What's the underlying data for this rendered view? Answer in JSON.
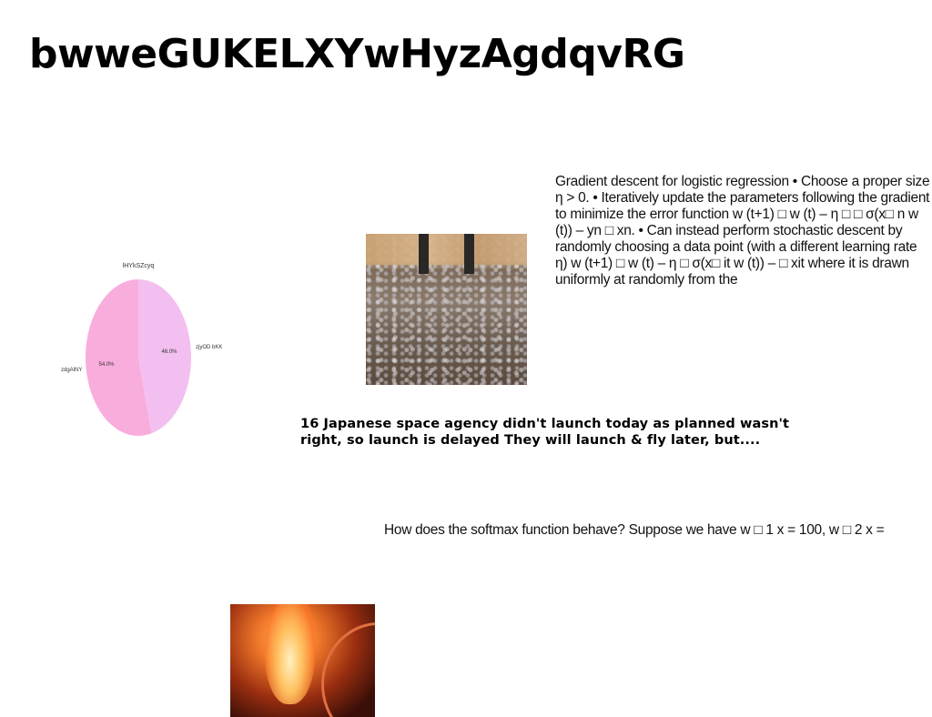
{
  "page": {
    "title": "bwweGUKELXYwHyzAgdqvRG"
  },
  "text_blocks": {
    "logistic": "Gradient descent for logistic regression • Choose a proper size η > 0. • Iteratively update the parameters following the gradient to minimize the error function w (t+1) □ w (t) – η □ □ σ(x□ n w (t)) – yn □ xn. • Can instead perform stochastic descent by randomly choosing a data point (with a different learning rate η) w (t+1) □ w (t) – η □ σ(x□ it w (t)) – □ xit where it is drawn uniformly at randomly from the",
    "caption": "16 Japanese space agency didn't launch today as planned wasn't right, so launch is delayed They will launch & fly later, but....",
    "softmax": "How does the softmax function behave? Suppose we have w □ 1 x = 100, w □ 2 x ="
  },
  "chart_data": {
    "type": "pie",
    "title": "lHYkSZcyq",
    "slices": [
      {
        "label": "zjyOD bKK",
        "value": 46.0,
        "pct_label": "46.0%",
        "color": "#f3bff0"
      },
      {
        "label": "zdgAlNY",
        "value": 54.0,
        "pct_label": "54.0%",
        "color": "#f9addd"
      }
    ],
    "start_angle_deg": 90,
    "direction": "clockwise"
  }
}
